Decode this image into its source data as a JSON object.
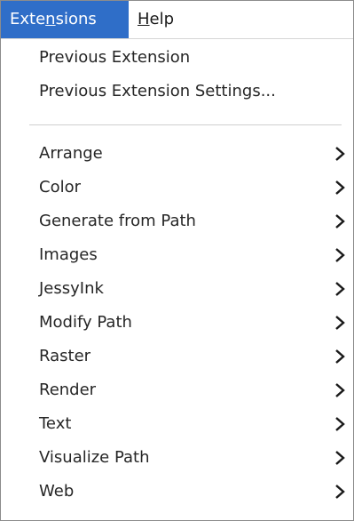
{
  "menubar": {
    "extensions": {
      "before": "Exte",
      "mnemonic": "n",
      "after": "sions"
    },
    "help": {
      "mnemonic": "H",
      "after": "elp"
    }
  },
  "menu": {
    "top_items": [
      {
        "label": "Previous Extension"
      },
      {
        "label": "Previous Extension Settings..."
      }
    ],
    "submenus": [
      {
        "label": "Arrange"
      },
      {
        "label": "Color"
      },
      {
        "label": "Generate from Path"
      },
      {
        "label": "Images"
      },
      {
        "label": "JessyInk"
      },
      {
        "label": "Modify Path"
      },
      {
        "label": "Raster"
      },
      {
        "label": "Render"
      },
      {
        "label": "Text"
      },
      {
        "label": "Visualize Path"
      },
      {
        "label": "Web"
      }
    ]
  },
  "colors": {
    "active_menu_bg": "#2f6ec8",
    "active_menu_fg": "#ffffff",
    "text": "#262626"
  },
  "icons": {
    "submenu_arrow": "chevron-right-icon"
  }
}
